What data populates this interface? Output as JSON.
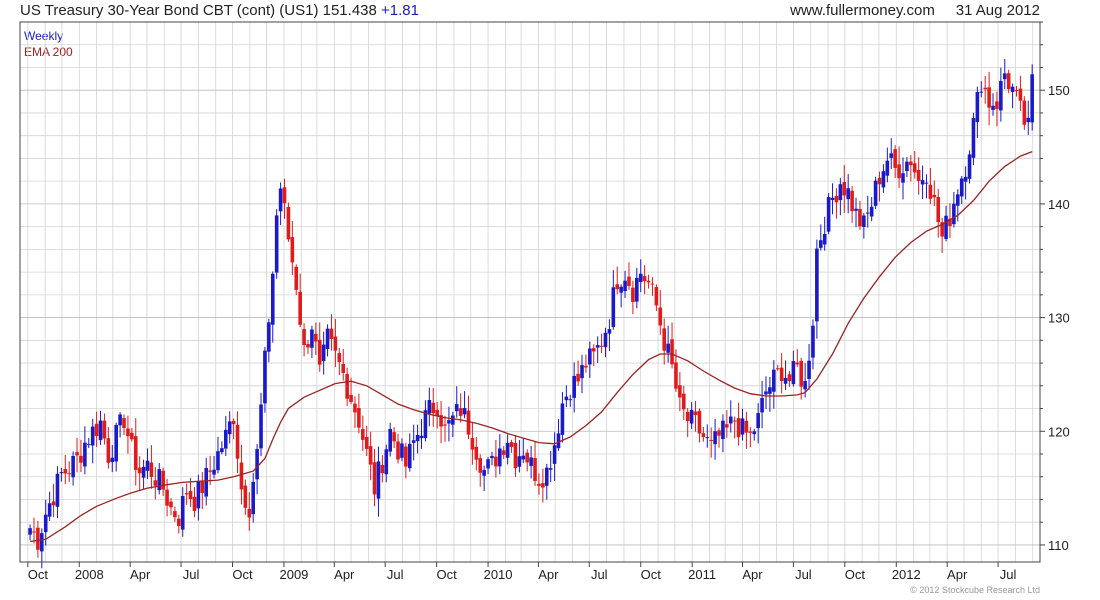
{
  "header": {
    "title": "US Treasury 30-Year  Bond CBT (cont) (US1) 151.438",
    "change": "+1.81",
    "site": "www.fullermoney.com",
    "date": "31 Aug 2012"
  },
  "legend": {
    "weekly": "Weekly",
    "ema": "EMA 200"
  },
  "copyright": "© 2012 Stockcube Research Ltd",
  "colors": {
    "up": "#1a1ac8",
    "down": "#e01b1b",
    "ema": "#9a2424",
    "grid": "#d4d4d4",
    "axis": "#444444"
  },
  "chart_data": {
    "type": "line",
    "title": "US Treasury 30-Year  Bond CBT (cont) (US1) 151.438",
    "xlabel": "",
    "ylabel": "",
    "ylim": [
      108.5,
      156
    ],
    "x_ticks": [
      "Oct",
      "2008",
      "Apr",
      "Jul",
      "Oct",
      "2009",
      "Apr",
      "Jul",
      "Oct",
      "2010",
      "Apr",
      "Jul",
      "Oct",
      "2011",
      "Apr",
      "Jul",
      "Oct",
      "2012",
      "Apr",
      "Jul"
    ],
    "y_ticks": [
      110,
      120,
      130,
      140,
      150
    ],
    "grid": true,
    "legend_position": "top-left",
    "series": [
      {
        "name": "Weekly",
        "style": "candlestick",
        "points": [
          [
            "2007-10-05",
            111.5
          ],
          [
            "2007-10-19",
            110.5
          ],
          [
            "2007-11-02",
            112.8
          ],
          [
            "2007-11-16",
            114.5
          ],
          [
            "2007-11-30",
            116.2
          ],
          [
            "2007-12-14",
            116.8
          ],
          [
            "2007-12-28",
            117.5
          ],
          [
            "2008-01-11",
            119.0
          ],
          [
            "2008-01-25",
            120.0
          ],
          [
            "2008-02-08",
            120.8
          ],
          [
            "2008-02-22",
            118.0
          ],
          [
            "2008-03-07",
            119.5
          ],
          [
            "2008-03-21",
            121.2
          ],
          [
            "2008-04-04",
            118.2
          ],
          [
            "2008-04-18",
            116.5
          ],
          [
            "2008-05-02",
            117.0
          ],
          [
            "2008-05-16",
            116.0
          ],
          [
            "2008-05-30",
            115.0
          ],
          [
            "2008-06-13",
            113.2
          ],
          [
            "2008-06-27",
            112.5
          ],
          [
            "2008-07-11",
            114.8
          ],
          [
            "2008-07-25",
            114.0
          ],
          [
            "2008-08-08",
            115.2
          ],
          [
            "2008-08-22",
            116.5
          ],
          [
            "2008-09-05",
            118.0
          ],
          [
            "2008-09-19",
            119.5
          ],
          [
            "2008-10-03",
            121.5
          ],
          [
            "2008-10-17",
            115.0
          ],
          [
            "2008-10-31",
            113.5
          ],
          [
            "2008-11-14",
            118.0
          ],
          [
            "2008-11-28",
            126.0
          ],
          [
            "2008-12-12",
            134.0
          ],
          [
            "2008-12-19",
            139.0
          ],
          [
            "2008-12-26",
            141.5
          ],
          [
            "2009-01-09",
            137.0
          ],
          [
            "2009-01-23",
            133.0
          ],
          [
            "2009-02-06",
            127.0
          ],
          [
            "2009-02-20",
            129.5
          ],
          [
            "2009-03-06",
            125.0
          ],
          [
            "2009-03-20",
            128.0
          ],
          [
            "2009-04-03",
            126.5
          ],
          [
            "2009-04-17",
            125.0
          ],
          [
            "2009-05-01",
            123.0
          ],
          [
            "2009-05-15",
            121.0
          ],
          [
            "2009-05-29",
            118.0
          ],
          [
            "2009-06-12",
            115.0
          ],
          [
            "2009-06-26",
            117.5
          ],
          [
            "2009-07-10",
            120.0
          ],
          [
            "2009-07-24",
            118.5
          ],
          [
            "2009-08-07",
            117.0
          ],
          [
            "2009-08-21",
            119.0
          ],
          [
            "2009-09-04",
            120.5
          ],
          [
            "2009-09-18",
            121.8
          ],
          [
            "2009-10-02",
            122.5
          ],
          [
            "2009-10-16",
            120.0
          ],
          [
            "2009-10-30",
            121.0
          ],
          [
            "2009-11-13",
            122.0
          ],
          [
            "2009-11-27",
            120.5
          ],
          [
            "2009-12-11",
            118.5
          ],
          [
            "2009-12-25",
            116.5
          ],
          [
            "2010-01-08",
            117.0
          ],
          [
            "2010-01-22",
            118.5
          ],
          [
            "2010-02-05",
            119.5
          ],
          [
            "2010-02-19",
            117.8
          ],
          [
            "2010-03-05",
            118.5
          ],
          [
            "2010-03-19",
            117.0
          ],
          [
            "2010-04-02",
            116.0
          ],
          [
            "2010-04-16",
            116.5
          ],
          [
            "2010-04-30",
            119.0
          ],
          [
            "2010-05-14",
            122.5
          ],
          [
            "2010-05-28",
            124.0
          ],
          [
            "2010-06-11",
            124.5
          ],
          [
            "2010-06-25",
            126.0
          ],
          [
            "2010-07-09",
            126.5
          ],
          [
            "2010-07-23",
            128.0
          ],
          [
            "2010-08-06",
            130.0
          ],
          [
            "2010-08-20",
            133.5
          ],
          [
            "2010-09-03",
            134.0
          ],
          [
            "2010-09-17",
            132.5
          ],
          [
            "2010-10-01",
            134.0
          ],
          [
            "2010-10-15",
            133.0
          ],
          [
            "2010-10-29",
            131.0
          ],
          [
            "2010-11-12",
            128.0
          ],
          [
            "2010-11-26",
            125.5
          ],
          [
            "2010-12-10",
            122.0
          ],
          [
            "2010-12-24",
            121.0
          ],
          [
            "2011-01-07",
            120.5
          ],
          [
            "2011-01-21",
            119.5
          ],
          [
            "2011-02-04",
            118.5
          ],
          [
            "2011-02-18",
            119.5
          ],
          [
            "2011-03-04",
            120.0
          ],
          [
            "2011-03-18",
            121.0
          ],
          [
            "2011-04-01",
            120.0
          ],
          [
            "2011-04-15",
            119.5
          ],
          [
            "2011-04-29",
            121.0
          ],
          [
            "2011-05-13",
            123.5
          ],
          [
            "2011-05-27",
            124.5
          ],
          [
            "2011-06-10",
            125.5
          ],
          [
            "2011-06-24",
            124.5
          ],
          [
            "2011-07-08",
            125.5
          ],
          [
            "2011-07-22",
            124.0
          ],
          [
            "2011-08-05",
            130.0
          ],
          [
            "2011-08-12",
            136.0
          ],
          [
            "2011-08-26",
            138.5
          ],
          [
            "2011-09-09",
            140.5
          ],
          [
            "2011-09-23",
            142.0
          ],
          [
            "2011-10-07",
            141.0
          ],
          [
            "2011-10-21",
            139.0
          ],
          [
            "2011-11-04",
            138.0
          ],
          [
            "2011-11-18",
            140.0
          ],
          [
            "2011-12-02",
            142.5
          ],
          [
            "2011-12-16",
            144.0
          ],
          [
            "2011-12-30",
            143.0
          ],
          [
            "2012-01-13",
            143.5
          ],
          [
            "2012-01-27",
            144.0
          ],
          [
            "2012-02-10",
            142.0
          ],
          [
            "2012-02-24",
            143.0
          ],
          [
            "2012-03-09",
            140.0
          ],
          [
            "2012-03-23",
            137.0
          ],
          [
            "2012-04-06",
            139.0
          ],
          [
            "2012-04-20",
            141.5
          ],
          [
            "2012-05-04",
            143.5
          ],
          [
            "2012-05-18",
            147.0
          ],
          [
            "2012-06-01",
            151.0
          ],
          [
            "2012-06-15",
            149.0
          ],
          [
            "2012-06-29",
            149.0
          ],
          [
            "2012-07-13",
            151.5
          ],
          [
            "2012-07-27",
            150.0
          ],
          [
            "2012-08-10",
            148.0
          ],
          [
            "2012-08-24",
            146.5
          ],
          [
            "2012-08-31",
            151.4
          ]
        ]
      },
      {
        "name": "EMA 200",
        "style": "line",
        "points": [
          [
            "2007-10-05",
            110.3
          ],
          [
            "2007-11-02",
            110.5
          ],
          [
            "2007-12-07",
            111.6
          ],
          [
            "2008-01-04",
            112.6
          ],
          [
            "2008-02-01",
            113.4
          ],
          [
            "2008-03-07",
            114.1
          ],
          [
            "2008-04-04",
            114.6
          ],
          [
            "2008-05-02",
            115.0
          ],
          [
            "2008-06-06",
            115.3
          ],
          [
            "2008-07-04",
            115.5
          ],
          [
            "2008-08-01",
            115.6
          ],
          [
            "2008-09-05",
            115.7
          ],
          [
            "2008-10-03",
            116.0
          ],
          [
            "2008-11-07",
            116.5
          ],
          [
            "2008-11-28",
            117.6
          ],
          [
            "2008-12-12",
            119.3
          ],
          [
            "2008-12-26",
            120.8
          ],
          [
            "2009-01-09",
            122.0
          ],
          [
            "2009-02-06",
            123.0
          ],
          [
            "2009-03-06",
            123.6
          ],
          [
            "2009-04-03",
            124.2
          ],
          [
            "2009-05-01",
            124.4
          ],
          [
            "2009-05-29",
            124.0
          ],
          [
            "2009-06-26",
            123.2
          ],
          [
            "2009-07-24",
            122.4
          ],
          [
            "2009-08-21",
            121.9
          ],
          [
            "2009-09-18",
            121.5
          ],
          [
            "2009-10-16",
            121.2
          ],
          [
            "2009-11-13",
            121.0
          ],
          [
            "2009-12-11",
            120.7
          ],
          [
            "2010-01-08",
            120.3
          ],
          [
            "2010-02-05",
            119.8
          ],
          [
            "2010-03-05",
            119.4
          ],
          [
            "2010-04-02",
            119.0
          ],
          [
            "2010-04-30",
            118.9
          ],
          [
            "2010-05-28",
            119.5
          ],
          [
            "2010-06-25",
            120.5
          ],
          [
            "2010-07-23",
            121.7
          ],
          [
            "2010-08-20",
            123.4
          ],
          [
            "2010-09-17",
            125.0
          ],
          [
            "2010-10-15",
            126.3
          ],
          [
            "2010-11-05",
            126.8
          ],
          [
            "2010-11-26",
            126.8
          ],
          [
            "2010-12-24",
            126.2
          ],
          [
            "2011-01-21",
            125.3
          ],
          [
            "2011-02-18",
            124.5
          ],
          [
            "2011-03-18",
            123.8
          ],
          [
            "2011-04-15",
            123.3
          ],
          [
            "2011-05-13",
            123.1
          ],
          [
            "2011-06-10",
            123.1
          ],
          [
            "2011-07-08",
            123.2
          ],
          [
            "2011-07-22",
            123.4
          ],
          [
            "2011-08-12",
            124.6
          ],
          [
            "2011-09-09",
            126.8
          ],
          [
            "2011-10-07",
            129.5
          ],
          [
            "2011-11-04",
            131.7
          ],
          [
            "2011-12-02",
            133.6
          ],
          [
            "2011-12-30",
            135.3
          ],
          [
            "2012-01-27",
            136.6
          ],
          [
            "2012-02-24",
            137.6
          ],
          [
            "2012-03-23",
            138.2
          ],
          [
            "2012-04-20",
            139.0
          ],
          [
            "2012-05-18",
            140.3
          ],
          [
            "2012-06-15",
            142.0
          ],
          [
            "2012-07-13",
            143.3
          ],
          [
            "2012-08-10",
            144.2
          ],
          [
            "2012-08-31",
            144.6
          ]
        ]
      }
    ]
  }
}
